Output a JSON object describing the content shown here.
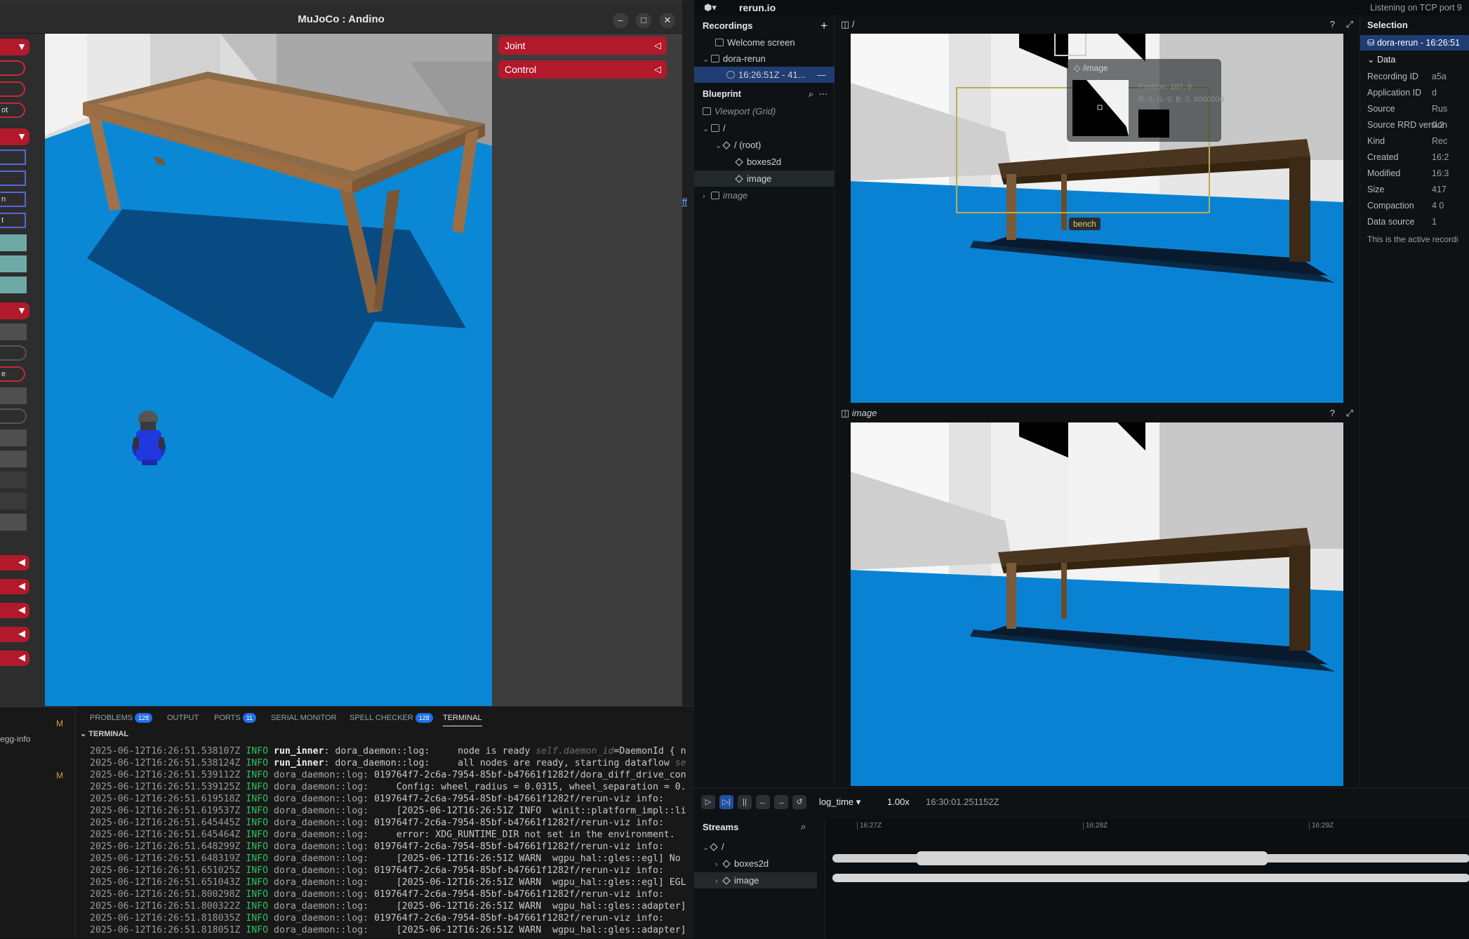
{
  "mujoco": {
    "title": "MuJoCo : Andino",
    "right_buttons": [
      "Joint",
      "Control"
    ],
    "left_partial_labels": [
      "ot",
      "n",
      "t",
      "e"
    ]
  },
  "ide": {
    "panel_tabs": [
      {
        "label": "PROBLEMS",
        "badge": "128"
      },
      {
        "label": "OUTPUT",
        "badge": ""
      },
      {
        "label": "PORTS",
        "badge": "11"
      },
      {
        "label": "SERIAL MONITOR",
        "badge": ""
      },
      {
        "label": "SPELL CHECKER",
        "badge": "128"
      },
      {
        "label": "TERMINAL",
        "badge": ""
      }
    ],
    "section_title": "TERMINAL",
    "sidebar_items": [
      "M",
      "egg-info",
      "M"
    ],
    "gap_text": "ff",
    "terminal_lines": [
      {
        "ts": "2025-06-12T16:26:51.538107Z",
        "lv": "INFO",
        "src": "run_inner",
        "src_bold": true,
        "rest": ": dora_daemon::log:     node is ready ",
        "it": "self.daemon_id",
        "tail": "=DaemonId { n"
      },
      {
        "ts": "2025-06-12T16:26:51.538124Z",
        "lv": "INFO",
        "src": "run_inner",
        "src_bold": true,
        "rest": ": dora_daemon::log:     all nodes are ready, starting dataflow ",
        "it": "se",
        "tail": ""
      },
      {
        "ts": "2025-06-12T16:26:51.539112Z",
        "lv": "INFO",
        "src": "dora_daemon::log:",
        "src_bold": false,
        "rest": " 019764f7-2c6a-7954-85bf-b47661f1282f/dora_diff_drive_con",
        "it": "",
        "tail": ""
      },
      {
        "ts": "2025-06-12T16:26:51.539125Z",
        "lv": "INFO",
        "src": "dora_daemon::log:",
        "src_bold": false,
        "rest": "     Config: wheel_radius = 0.0315, wheel_separation = 0.",
        "it": "",
        "tail": ""
      },
      {
        "ts": "2025-06-12T16:26:51.619518Z",
        "lv": "INFO",
        "src": "dora_daemon::log:",
        "src_bold": false,
        "rest": " 019764f7-2c6a-7954-85bf-b47661f1282f/rerun-viz info:",
        "it": "",
        "tail": ""
      },
      {
        "ts": "2025-06-12T16:26:51.619537Z",
        "lv": "INFO",
        "src": "dora_daemon::log:",
        "src_bold": false,
        "rest": "     [2025-06-12T16:26:51Z INFO  winit::platform_impl::li",
        "it": "",
        "tail": ""
      },
      {
        "ts": "2025-06-12T16:26:51.645445Z",
        "lv": "INFO",
        "src": "dora_daemon::log:",
        "src_bold": false,
        "rest": " 019764f7-2c6a-7954-85bf-b47661f1282f/rerun-viz info:",
        "it": "",
        "tail": ""
      },
      {
        "ts": "2025-06-12T16:26:51.645464Z",
        "lv": "INFO",
        "src": "dora_daemon::log:",
        "src_bold": false,
        "rest": "     error: XDG_RUNTIME_DIR not set in the environment.",
        "it": "",
        "tail": ""
      },
      {
        "ts": "2025-06-12T16:26:51.648299Z",
        "lv": "INFO",
        "src": "dora_daemon::log:",
        "src_bold": false,
        "rest": " 019764f7-2c6a-7954-85bf-b47661f1282f/rerun-viz info:",
        "it": "",
        "tail": ""
      },
      {
        "ts": "2025-06-12T16:26:51.648319Z",
        "lv": "INFO",
        "src": "dora_daemon::log:",
        "src_bold": false,
        "rest": "     [2025-06-12T16:26:51Z WARN  wgpu_hal::gles::egl] No",
        "it": "",
        "tail": ""
      },
      {
        "ts": "2025-06-12T16:26:51.651025Z",
        "lv": "INFO",
        "src": "dora_daemon::log:",
        "src_bold": false,
        "rest": " 019764f7-2c6a-7954-85bf-b47661f1282f/rerun-viz info:",
        "it": "",
        "tail": ""
      },
      {
        "ts": "2025-06-12T16:26:51.651043Z",
        "lv": "INFO",
        "src": "dora_daemon::log:",
        "src_bold": false,
        "rest": "     [2025-06-12T16:26:51Z WARN  wgpu_hal::gles::egl] EGL",
        "it": "",
        "tail": ""
      },
      {
        "ts": "2025-06-12T16:26:51.800298Z",
        "lv": "INFO",
        "src": "dora_daemon::log:",
        "src_bold": false,
        "rest": " 019764f7-2c6a-7954-85bf-b47661f1282f/rerun-viz info:",
        "it": "",
        "tail": ""
      },
      {
        "ts": "2025-06-12T16:26:51.800322Z",
        "lv": "INFO",
        "src": "dora_daemon::log:",
        "src_bold": false,
        "rest": "     [2025-06-12T16:26:51Z WARN  wgpu_hal::gles::adapter]",
        "it": "",
        "tail": ""
      },
      {
        "ts": "2025-06-12T16:26:51.818035Z",
        "lv": "INFO",
        "src": "dora_daemon::log:",
        "src_bold": false,
        "rest": " 019764f7-2c6a-7954-85bf-b47661f1282f/rerun-viz info:",
        "it": "",
        "tail": ""
      },
      {
        "ts": "2025-06-12T16:26:51.818051Z",
        "lv": "INFO",
        "src": "dora_daemon::log:",
        "src_bold": false,
        "rest": "     [2025-06-12T16:26:51Z WARN  wgpu_hal::gles::adapter]",
        "it": "",
        "tail": ""
      }
    ]
  },
  "rerun": {
    "app_name": "rerun.io",
    "status": "Listening on TCP port 9",
    "recordings_title": "Recordings",
    "welcome": "Welcome screen",
    "app_id": "dora-rerun",
    "recording": "16:26:51Z - 41...",
    "blueprint_title": "Blueprint",
    "viewport": "Viewport (Grid)",
    "view_root": "/",
    "root_entity": "/ (root)",
    "entity_boxes": "boxes2d",
    "entity_image": "image",
    "view_image": "image",
    "view1_title": "/",
    "view2_title": "image",
    "help": "?",
    "hover": {
      "path": "/image",
      "position": "Position:  187, 9",
      "rgb": "R: 0, G: 0, B: 0, #000000"
    },
    "box_label": "bench",
    "selection": {
      "title": "Selection",
      "item": "dora-rerun - 16:26:51",
      "section": "Data",
      "rows": [
        {
          "k": "Recording ID",
          "v": "a5a"
        },
        {
          "k": "Application ID",
          "v": "d"
        },
        {
          "k": "Source",
          "v": "Rus"
        },
        {
          "k": "Source RRD version",
          "v": "0.2"
        },
        {
          "k": "Kind",
          "v": "Rec"
        },
        {
          "k": "Created",
          "v": "16:2"
        },
        {
          "k": "Modified",
          "v": "16:3"
        },
        {
          "k": "Size",
          "v": "417"
        },
        {
          "k": "Compaction",
          "v": "4 0"
        },
        {
          "k": "Data source",
          "v": "1"
        }
      ],
      "note": "This is the active recordi"
    },
    "timeline": {
      "timeline_name": "log_time",
      "speed": "1.00x",
      "current_time": "16:30:01.251152Z",
      "streams_title": "Streams",
      "ticks": [
        "16:27Z",
        "16:28Z",
        "16:29Z"
      ],
      "stream_root": "/",
      "stream_boxes": "boxes2d",
      "stream_image": "image"
    }
  },
  "colors": {
    "accent": "#1f3d73",
    "mujoco_red": "#b2192b",
    "floor_blue": "#0a88d6",
    "table": "#b07f52"
  }
}
